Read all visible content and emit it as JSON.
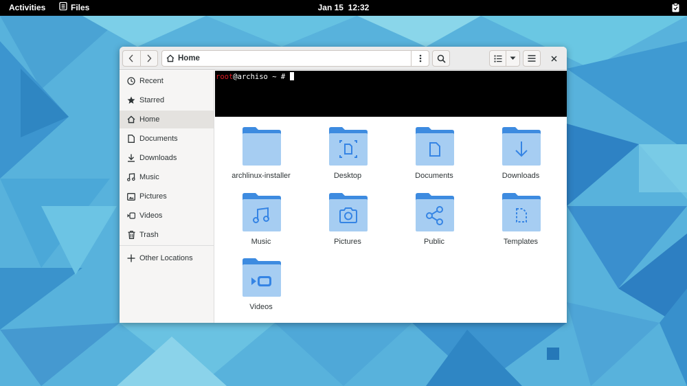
{
  "topbar": {
    "activities": "Activities",
    "app_name": "Files",
    "date": "Jan 15",
    "time": "12:32"
  },
  "headerbar": {
    "location": "Home",
    "icons": {
      "back": "chevron-left-icon",
      "forward": "chevron-right-icon",
      "location": "home-icon",
      "path_menu": "kebab-menu-icon",
      "search": "search-icon",
      "view": "list-view-icon",
      "view_options": "chevron-down-icon",
      "main_menu": "hamburger-menu-icon",
      "close": "close-icon"
    }
  },
  "sidebar": {
    "items": [
      {
        "label": "Recent",
        "icon": "clock-icon"
      },
      {
        "label": "Starred",
        "icon": "star-icon"
      },
      {
        "label": "Home",
        "icon": "home-icon",
        "active": true
      },
      {
        "label": "Documents",
        "icon": "document-icon"
      },
      {
        "label": "Downloads",
        "icon": "download-icon"
      },
      {
        "label": "Music",
        "icon": "music-icon"
      },
      {
        "label": "Pictures",
        "icon": "image-icon"
      },
      {
        "label": "Videos",
        "icon": "video-icon"
      },
      {
        "label": "Trash",
        "icon": "trash-icon"
      }
    ],
    "other_locations": {
      "label": "Other Locations",
      "icon": "plus-icon"
    }
  },
  "terminal": {
    "user": "root",
    "host": "@archiso",
    "prompt": " ~ # "
  },
  "files": [
    {
      "name": "archlinux-installer",
      "emblem": "none"
    },
    {
      "name": "Desktop",
      "emblem": "desktop"
    },
    {
      "name": "Documents",
      "emblem": "document"
    },
    {
      "name": "Downloads",
      "emblem": "download"
    },
    {
      "name": "Music",
      "emblem": "music"
    },
    {
      "name": "Pictures",
      "emblem": "camera"
    },
    {
      "name": "Public",
      "emblem": "share"
    },
    {
      "name": "Templates",
      "emblem": "template"
    },
    {
      "name": "Videos",
      "emblem": "video"
    }
  ],
  "colors": {
    "folder_back": "#3d8be0",
    "folder_front": "#a6cdf2",
    "folder_emblem": "#3584e4",
    "prompt_user": "#e01b24"
  }
}
